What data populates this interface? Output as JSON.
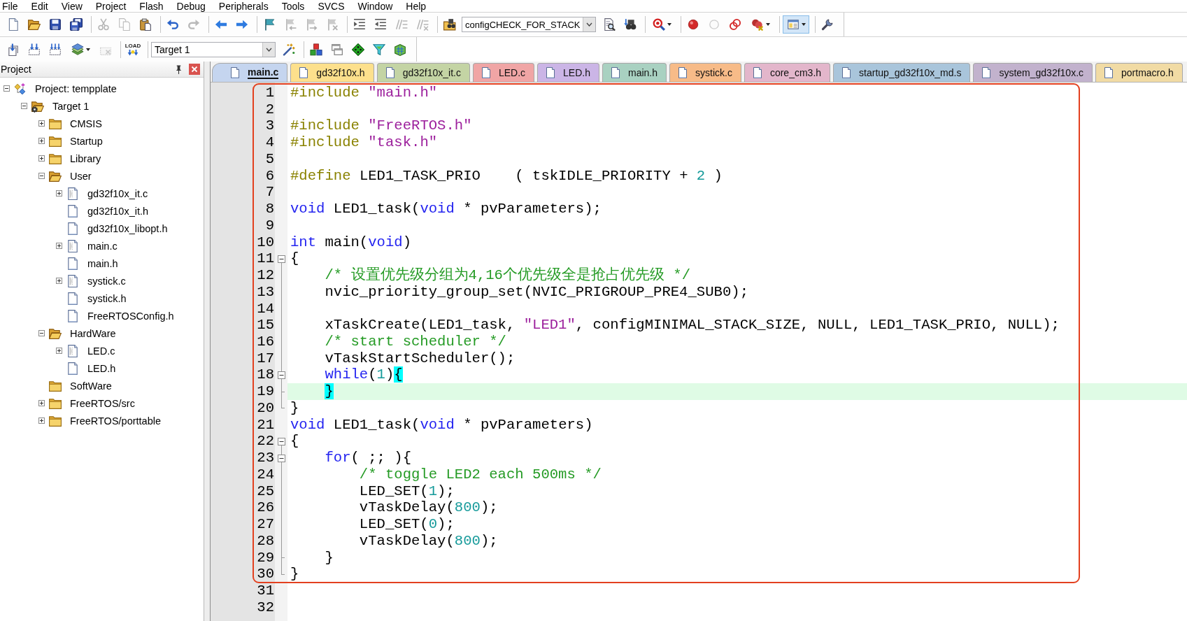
{
  "menu_bar": {
    "items": [
      "File",
      "Edit",
      "View",
      "Project",
      "Flash",
      "Debug",
      "Peripherals",
      "Tools",
      "SVCS",
      "Window",
      "Help"
    ]
  },
  "toolbars": [
    {
      "items": [
        {
          "kind": "button",
          "disabled": false,
          "pressed": false
        },
        {
          "kind": "button",
          "disabled": false,
          "pressed": false
        },
        {
          "kind": "button",
          "disabled": false,
          "pressed": false
        },
        {
          "kind": "button",
          "disabled": false,
          "pressed": false
        },
        {
          "kind": "separator"
        },
        {
          "kind": "button",
          "disabled": true,
          "pressed": false
        },
        {
          "kind": "button",
          "disabled": true,
          "pressed": false
        },
        {
          "kind": "button",
          "disabled": false,
          "pressed": false
        },
        {
          "kind": "separator"
        },
        {
          "kind": "button",
          "disabled": false,
          "pressed": false
        },
        {
          "kind": "button",
          "disabled": true,
          "pressed": false
        },
        {
          "kind": "separator"
        },
        {
          "kind": "button",
          "disabled": false,
          "pressed": false
        },
        {
          "kind": "button",
          "disabled": false,
          "pressed": false
        },
        {
          "kind": "separator"
        },
        {
          "kind": "button",
          "disabled": false,
          "pressed": false
        },
        {
          "kind": "button",
          "disabled": true,
          "pressed": false
        },
        {
          "kind": "button",
          "disabled": true,
          "pressed": false
        },
        {
          "kind": "button",
          "disabled": true,
          "pressed": false
        },
        {
          "kind": "separator"
        },
        {
          "kind": "button",
          "disabled": false,
          "pressed": false
        },
        {
          "kind": "button",
          "disabled": false,
          "pressed": false
        },
        {
          "kind": "button",
          "disabled": true,
          "pressed": false
        },
        {
          "kind": "button",
          "disabled": true,
          "pressed": false
        },
        {
          "kind": "separator"
        },
        {
          "kind": "button",
          "disabled": false,
          "pressed": false
        },
        {
          "kind": "combo",
          "value": "configCHECK_FOR_STACK"
        },
        {
          "kind": "button",
          "disabled": false,
          "pressed": false
        },
        {
          "kind": "button",
          "disabled": false,
          "pressed": false
        },
        {
          "kind": "separator"
        },
        {
          "kind": "split",
          "disabled": false,
          "pressed": false
        },
        {
          "kind": "separator"
        },
        {
          "kind": "button",
          "disabled": false,
          "pressed": false
        },
        {
          "kind": "button",
          "disabled": true,
          "pressed": false
        },
        {
          "kind": "button",
          "disabled": false,
          "pressed": false
        },
        {
          "kind": "split",
          "disabled": false,
          "pressed": false
        },
        {
          "kind": "separator"
        },
        {
          "kind": "split",
          "disabled": false,
          "pressed": true
        },
        {
          "kind": "separator"
        },
        {
          "kind": "button",
          "disabled": false,
          "pressed": false
        }
      ]
    },
    {
      "items": [
        {
          "kind": "button",
          "disabled": false,
          "pressed": false
        },
        {
          "kind": "button",
          "disabled": false,
          "pressed": false
        },
        {
          "kind": "button",
          "disabled": false,
          "pressed": false
        },
        {
          "kind": "split",
          "disabled": false,
          "pressed": false
        },
        {
          "kind": "button",
          "disabled": true,
          "pressed": false
        },
        {
          "kind": "separator"
        },
        {
          "kind": "button",
          "label": "LOAD",
          "disabled": false,
          "pressed": false
        },
        {
          "kind": "separator"
        },
        {
          "kind": "combo",
          "value": "Target 1"
        },
        {
          "kind": "button",
          "disabled": false,
          "pressed": false
        },
        {
          "kind": "separator"
        },
        {
          "kind": "button",
          "disabled": false,
          "pressed": false
        },
        {
          "kind": "button",
          "disabled": false,
          "pressed": false
        },
        {
          "kind": "button",
          "disabled": false,
          "pressed": false
        },
        {
          "kind": "button",
          "disabled": false,
          "pressed": false
        },
        {
          "kind": "button",
          "disabled": false,
          "pressed": false
        }
      ]
    }
  ],
  "project_panel": {
    "title": "Project",
    "tree": [
      {
        "label": "Project: tempplate",
        "kind": "project",
        "expanded": true,
        "children": [
          {
            "label": "Target 1",
            "kind": "target",
            "expanded": true,
            "children": [
              {
                "label": "CMSIS",
                "kind": "group",
                "expanded": false
              },
              {
                "label": "Startup",
                "kind": "group",
                "expanded": false
              },
              {
                "label": "Library",
                "kind": "group",
                "expanded": false
              },
              {
                "label": "User",
                "kind": "group",
                "expanded": true,
                "children": [
                  {
                    "label": "gd32f10x_it.c",
                    "kind": "file",
                    "expanded": false
                  },
                  {
                    "label": "gd32f10x_it.h",
                    "kind": "file"
                  },
                  {
                    "label": "gd32f10x_libopt.h",
                    "kind": "file"
                  },
                  {
                    "label": "main.c",
                    "kind": "file",
                    "expanded": false
                  },
                  {
                    "label": "main.h",
                    "kind": "file"
                  },
                  {
                    "label": "systick.c",
                    "kind": "file",
                    "expanded": false
                  },
                  {
                    "label": "systick.h",
                    "kind": "file"
                  },
                  {
                    "label": "FreeRTOSConfig.h",
                    "kind": "file"
                  }
                ]
              },
              {
                "label": "HardWare",
                "kind": "group",
                "expanded": true,
                "children": [
                  {
                    "label": "LED.c",
                    "kind": "file",
                    "expanded": false
                  },
                  {
                    "label": "LED.h",
                    "kind": "file"
                  }
                ]
              },
              {
                "label": "SoftWare",
                "kind": "group"
              },
              {
                "label": "FreeRTOS/src",
                "kind": "group",
                "expanded": false
              },
              {
                "label": "FreeRTOS/porttable",
                "kind": "group",
                "expanded": false
              }
            ]
          }
        ]
      }
    ]
  },
  "editor": {
    "tabs": [
      {
        "label": "main.c",
        "selected": true,
        "color": "#c5d5ef"
      },
      {
        "label": "gd32f10x.h",
        "selected": false,
        "color": "#fde08c"
      },
      {
        "label": "gd32f10x_it.c",
        "selected": false,
        "color": "#c4d4a4"
      },
      {
        "label": "LED.c",
        "selected": false,
        "color": "#f0a5a5"
      },
      {
        "label": "LED.h",
        "selected": false,
        "color": "#cbb5e6"
      },
      {
        "label": "main.h",
        "selected": false,
        "color": "#a9d1c1"
      },
      {
        "label": "systick.c",
        "selected": false,
        "color": "#f7bb88"
      },
      {
        "label": "core_cm3.h",
        "selected": false,
        "color": "#e3b6cb"
      },
      {
        "label": "startup_gd32f10x_md.s",
        "selected": false,
        "color": "#a9c5db"
      },
      {
        "label": "system_gd32f10x.c",
        "selected": false,
        "color": "#c2b2cd"
      },
      {
        "label": "portmacro.h",
        "selected": false,
        "color": "#f1dba4"
      }
    ],
    "lines": [
      {
        "number": "1",
        "kind": "plain",
        "current": false,
        "tokens": [
          {
            "kind": "preprocessor",
            "text": "#include "
          },
          {
            "kind": "string",
            "text": "\"main.h\""
          }
        ]
      },
      {
        "number": "2",
        "kind": "plain",
        "current": false
      },
      {
        "number": "3",
        "kind": "plain",
        "current": false,
        "tokens": [
          {
            "kind": "preprocessor",
            "text": "#include "
          },
          {
            "kind": "string",
            "text": "\"FreeRTOS.h\""
          }
        ]
      },
      {
        "number": "4",
        "kind": "plain",
        "current": false,
        "tokens": [
          {
            "kind": "preprocessor",
            "text": "#include "
          },
          {
            "kind": "string",
            "text": "\"task.h\""
          }
        ]
      },
      {
        "number": "5",
        "kind": "plain",
        "current": false
      },
      {
        "number": "6",
        "kind": "plain",
        "current": false,
        "tokens": [
          {
            "kind": "preprocessor",
            "text": "#define "
          },
          {
            "kind": "plain",
            "text": "LED1_TASK_PRIO    ( tskIDLE_PRIORITY + "
          },
          {
            "kind": "number",
            "text": "2"
          },
          {
            "kind": "plain",
            "text": " )"
          }
        ]
      },
      {
        "number": "7",
        "kind": "plain",
        "current": false
      },
      {
        "number": "8",
        "kind": "plain",
        "current": false,
        "tokens": [
          {
            "kind": "keyword",
            "text": "void"
          },
          {
            "kind": "plain",
            "text": " LED1_task("
          },
          {
            "kind": "keyword",
            "text": "void"
          },
          {
            "kind": "plain",
            "text": " * pvParameters);"
          }
        ]
      },
      {
        "number": "9",
        "kind": "plain",
        "current": false
      },
      {
        "number": "10",
        "kind": "plain",
        "current": false,
        "tokens": [
          {
            "kind": "keyword",
            "text": "int"
          },
          {
            "kind": "plain",
            "text": " main("
          },
          {
            "kind": "keyword",
            "text": "void"
          },
          {
            "kind": "plain",
            "text": ")"
          }
        ]
      },
      {
        "number": "11",
        "kind": "fold_start",
        "current": false,
        "tokens": [
          {
            "kind": "plain",
            "text": "{"
          }
        ]
      },
      {
        "number": "12",
        "kind": "fold_line",
        "current": false,
        "tokens": [
          {
            "kind": "comment",
            "text": "    /* 设置优先级分组为4,16个优先级全是抢占优先级 */"
          }
        ]
      },
      {
        "number": "13",
        "kind": "fold_line",
        "current": false,
        "tokens": [
          {
            "kind": "plain",
            "text": "    nvic_priority_group_set(NVIC_PRIGROUP_PRE4_SUB0);"
          }
        ]
      },
      {
        "number": "14",
        "kind": "fold_line",
        "current": false
      },
      {
        "number": "15",
        "kind": "fold_line",
        "current": false,
        "tokens": [
          {
            "kind": "plain",
            "text": "    xTaskCreate(LED1_task, "
          },
          {
            "kind": "string",
            "text": "\"LED1\""
          },
          {
            "kind": "plain",
            "text": ", configMINIMAL_STACK_SIZE, NULL, LED1_TASK_PRIO, NULL);"
          }
        ]
      },
      {
        "number": "16",
        "kind": "fold_line",
        "current": false,
        "tokens": [
          {
            "kind": "comment",
            "text": "    /* start scheduler */"
          }
        ]
      },
      {
        "number": "17",
        "kind": "fold_line",
        "current": false,
        "tokens": [
          {
            "kind": "plain",
            "text": "    vTaskStartScheduler();"
          }
        ]
      },
      {
        "number": "18",
        "kind": "fold_inner_start",
        "current": false,
        "tokens": [
          {
            "kind": "keyword",
            "text": "    while"
          },
          {
            "kind": "plain",
            "text": "("
          },
          {
            "kind": "number",
            "text": "1"
          },
          {
            "kind": "plain",
            "text": ")"
          },
          {
            "kind": "brace_match",
            "text": "{"
          }
        ]
      },
      {
        "number": "19",
        "kind": "fold_inner_end",
        "current": true,
        "tokens": [
          {
            "kind": "brace_match",
            "text": "    }"
          }
        ]
      },
      {
        "number": "20",
        "kind": "fold_end",
        "current": false,
        "tokens": [
          {
            "kind": "plain",
            "text": "}"
          }
        ]
      },
      {
        "number": "21",
        "kind": "plain",
        "current": false,
        "tokens": [
          {
            "kind": "keyword",
            "text": "void"
          },
          {
            "kind": "plain",
            "text": " LED1_task("
          },
          {
            "kind": "keyword",
            "text": "void"
          },
          {
            "kind": "plain",
            "text": " * pvParameters)"
          }
        ]
      },
      {
        "number": "22",
        "kind": "fold_start",
        "current": false,
        "tokens": [
          {
            "kind": "plain",
            "text": "{"
          }
        ]
      },
      {
        "number": "23",
        "kind": "fold_inner_start",
        "current": false,
        "tokens": [
          {
            "kind": "keyword",
            "text": "    for"
          },
          {
            "kind": "plain",
            "text": "( ;; ){"
          }
        ]
      },
      {
        "number": "24",
        "kind": "fold_line",
        "current": false,
        "tokens": [
          {
            "kind": "comment",
            "text": "        /* toggle LED2 each 500ms */"
          }
        ]
      },
      {
        "number": "25",
        "kind": "fold_line",
        "current": false,
        "tokens": [
          {
            "kind": "plain",
            "text": "        LED_SET("
          },
          {
            "kind": "number",
            "text": "1"
          },
          {
            "kind": "plain",
            "text": ");"
          }
        ]
      },
      {
        "number": "26",
        "kind": "fold_line",
        "current": false,
        "tokens": [
          {
            "kind": "plain",
            "text": "        vTaskDelay("
          },
          {
            "kind": "number",
            "text": "800"
          },
          {
            "kind": "plain",
            "text": ");"
          }
        ]
      },
      {
        "number": "27",
        "kind": "fold_line",
        "current": false,
        "tokens": [
          {
            "kind": "plain",
            "text": "        LED_SET("
          },
          {
            "kind": "number",
            "text": "0"
          },
          {
            "kind": "plain",
            "text": ");"
          }
        ]
      },
      {
        "number": "28",
        "kind": "fold_line",
        "current": false,
        "tokens": [
          {
            "kind": "plain",
            "text": "        vTaskDelay("
          },
          {
            "kind": "number",
            "text": "800"
          },
          {
            "kind": "plain",
            "text": ");"
          }
        ]
      },
      {
        "number": "29",
        "kind": "fold_inner_end",
        "current": false,
        "tokens": [
          {
            "kind": "plain",
            "text": "    }"
          }
        ]
      },
      {
        "number": "30",
        "kind": "fold_end",
        "current": false,
        "tokens": [
          {
            "kind": "plain",
            "text": "}"
          }
        ]
      },
      {
        "number": "31",
        "kind": "plain",
        "current": false
      },
      {
        "number": "32",
        "kind": "plain",
        "current": false
      }
    ]
  }
}
